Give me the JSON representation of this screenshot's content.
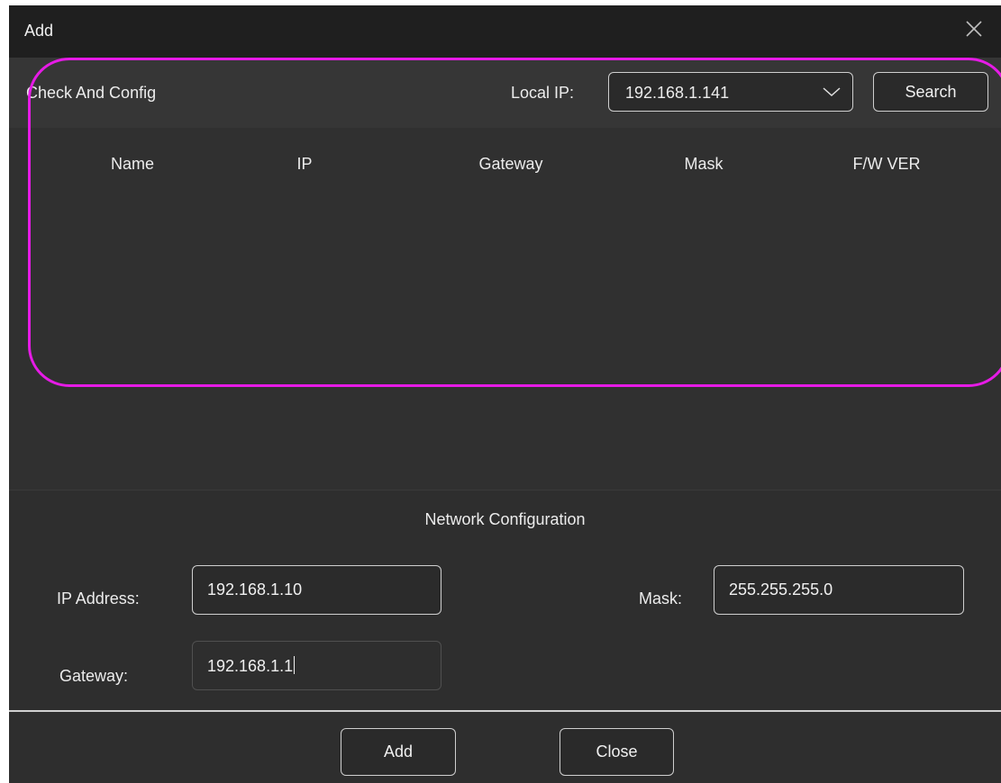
{
  "window": {
    "title": "Add"
  },
  "check": {
    "section_label": "Check And Config",
    "local_ip_label": "Local IP:",
    "local_ip_selected": "192.168.1.141",
    "search_label": "Search"
  },
  "table": {
    "headers": [
      "Name",
      "IP",
      "Gateway",
      "Mask",
      "F/W VER"
    ],
    "rows": []
  },
  "network": {
    "title": "Network Configuration",
    "ip_label": "IP Address:",
    "ip_value": "192.168.1.10",
    "mask_label": "Mask:",
    "mask_value": "255.255.255.0",
    "gateway_label": "Gateway:",
    "gateway_value": "192.168.1.1"
  },
  "footer": {
    "add_label": "Add",
    "close_label": "Close"
  },
  "colors": {
    "background": "#2e2e2e",
    "titlebar": "#1f1f1f",
    "highlight": "#e61be6"
  },
  "icons": {
    "close": "close-icon",
    "dropdown": "chevron-down-icon"
  }
}
